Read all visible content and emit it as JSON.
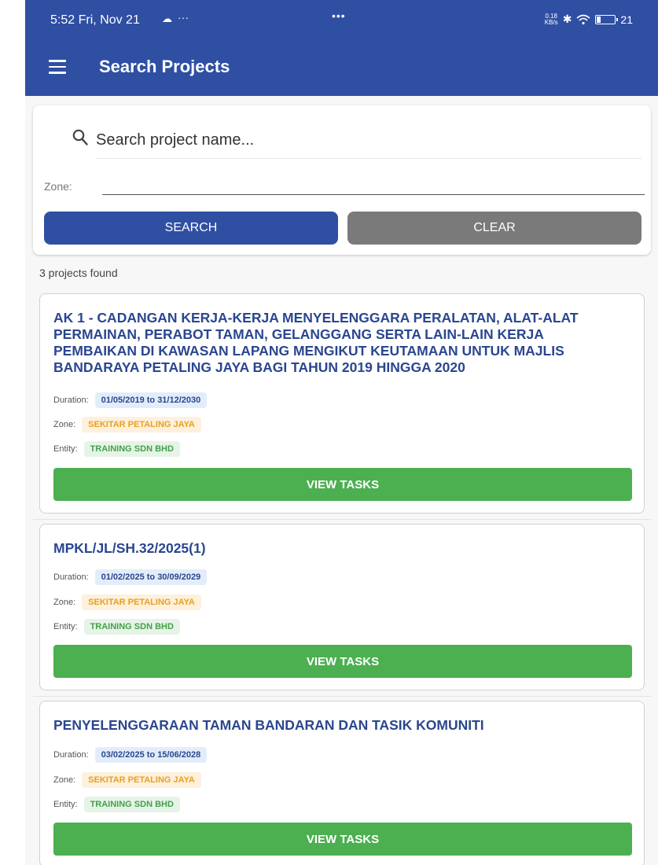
{
  "status_bar": {
    "time": "5:52",
    "date": "Fri, Nov 21",
    "more": "···",
    "center_dots": "•••",
    "net_speed_value": "0.18",
    "net_speed_unit": "KB/s",
    "battery": "21"
  },
  "app_bar": {
    "title": "Search Projects"
  },
  "search": {
    "placeholder": "Search project name...",
    "zone_label": "Zone:",
    "zone_value": "",
    "search_button": "SEARCH",
    "clear_button": "CLEAR"
  },
  "results": {
    "count_text": "3 projects found"
  },
  "labels": {
    "duration": "Duration:",
    "zone": "Zone:",
    "entity": "Entity:",
    "view_tasks": "VIEW TASKS"
  },
  "projects": [
    {
      "title": "AK 1 - CADANGAN KERJA-KERJA MENYELENGGARA PERALATAN, ALAT-ALAT PERMAINAN, PERABOT TAMAN, GELANGGANG SERTA LAIN-LAIN KERJA PEMBAIKAN DI KAWASAN LAPANG MENGIKUT KEUTAMAAN UNTUK MAJLIS BANDARAYA PETALING JAYA BAGI TAHUN 2019 HINGGA 2020",
      "duration": "01/05/2019 to 31/12/2030",
      "zone": "SEKITAR PETALING JAYA",
      "entity": "TRAINING SDN BHD"
    },
    {
      "title": "MPKL/JL/SH.32/2025(1)",
      "duration": "01/02/2025 to 30/09/2029",
      "zone": "SEKITAR PETALING JAYA",
      "entity": "TRAINING SDN BHD"
    },
    {
      "title": "PENYELENGGARAAN TAMAN BANDARAN DAN TASIK KOMUNITI",
      "duration": "03/02/2025 to 15/06/2028",
      "zone": "SEKITAR PETALING JAYA",
      "entity": "TRAINING SDN BHD"
    }
  ],
  "colors": {
    "primary": "#2f4fa3",
    "clear_button": "#7a7a7a",
    "view_tasks": "#4caf50",
    "title_text": "#2a468f",
    "zone_chip_text": "#e8a021",
    "entity_chip_text": "#44a04a"
  }
}
